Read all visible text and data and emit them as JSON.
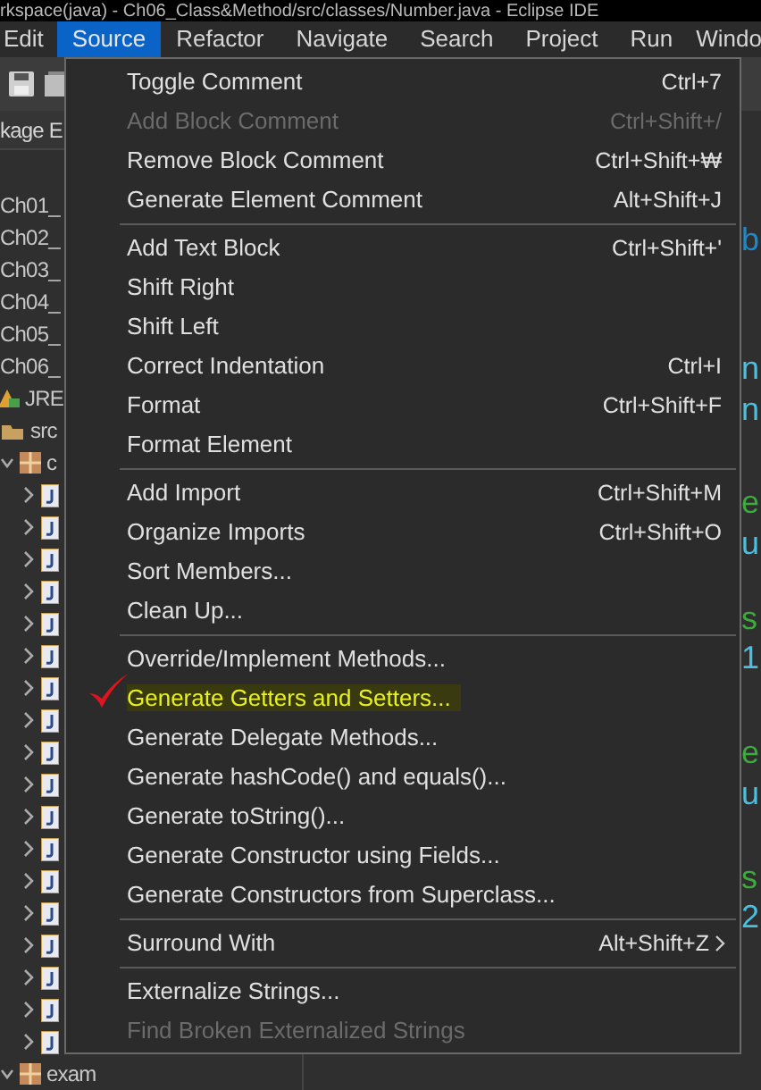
{
  "window": {
    "title": "rkspace(java) - Ch06_Class&Method/src/classes/Number.java - Eclipse IDE"
  },
  "menu_bar": [
    {
      "label": "Edit",
      "selected": false
    },
    {
      "label": "Source",
      "selected": true
    },
    {
      "label": "Refactor",
      "selected": false
    },
    {
      "label": "Navigate",
      "selected": false
    },
    {
      "label": "Search",
      "selected": false
    },
    {
      "label": "Project",
      "selected": false
    },
    {
      "label": "Run",
      "selected": false
    },
    {
      "label": "Windo",
      "selected": false
    }
  ],
  "left_panel": {
    "tab": "kage E",
    "tree": [
      {
        "label": "Ch01_",
        "kind": "project"
      },
      {
        "label": "Ch02_",
        "kind": "project"
      },
      {
        "label": "Ch03_",
        "kind": "project"
      },
      {
        "label": "Ch04_",
        "kind": "project"
      },
      {
        "label": "Ch05_",
        "kind": "project"
      },
      {
        "label": "Ch06_",
        "kind": "project"
      },
      {
        "label": "JRE",
        "kind": "library"
      },
      {
        "label": "src",
        "kind": "folder"
      },
      {
        "label": "c",
        "kind": "package",
        "expanded": true,
        "children": [
          {
            "kind": "java-file",
            "expanded": false
          },
          {
            "kind": "java-file",
            "expanded": false
          },
          {
            "kind": "java-file",
            "expanded": false
          },
          {
            "kind": "java-file",
            "expanded": false
          },
          {
            "kind": "java-file",
            "expanded": false
          },
          {
            "kind": "java-file",
            "expanded": false
          },
          {
            "kind": "java-file",
            "expanded": false
          },
          {
            "kind": "java-file",
            "expanded": false
          },
          {
            "kind": "java-file",
            "expanded": false
          },
          {
            "kind": "java-file",
            "expanded": false
          },
          {
            "kind": "java-file",
            "expanded": false
          },
          {
            "kind": "java-file",
            "expanded": false
          },
          {
            "kind": "java-file",
            "expanded": false
          },
          {
            "kind": "java-file",
            "expanded": false
          },
          {
            "kind": "java-file",
            "expanded": false
          },
          {
            "kind": "java-file",
            "expanded": false
          },
          {
            "kind": "java-file",
            "expanded": false
          },
          {
            "kind": "java-file",
            "expanded": false
          }
        ]
      },
      {
        "label": "exam",
        "kind": "package",
        "expanded": true
      }
    ]
  },
  "editor_fragments": [
    {
      "text": "b",
      "kind": "field"
    },
    {
      "text": "n",
      "kind": "type"
    },
    {
      "text": "n",
      "kind": "type"
    },
    {
      "text": "e",
      "kind": "comment"
    },
    {
      "text": "u",
      "kind": "type"
    },
    {
      "text": "s",
      "kind": "comment"
    },
    {
      "text": "1",
      "kind": "type"
    },
    {
      "text": "e",
      "kind": "comment"
    },
    {
      "text": "u",
      "kind": "type"
    },
    {
      "text": "s",
      "kind": "comment"
    },
    {
      "text": "2",
      "kind": "type"
    }
  ],
  "source_menu": [
    [
      {
        "label": "Toggle Comment",
        "shortcut": "Ctrl+7",
        "disabled": false,
        "submenu": false,
        "highlighted": false
      },
      {
        "label": "Add Block Comment",
        "shortcut": "Ctrl+Shift+/",
        "disabled": true,
        "submenu": false,
        "highlighted": false
      },
      {
        "label": "Remove Block Comment",
        "shortcut": "Ctrl+Shift+₩",
        "disabled": false,
        "submenu": false,
        "highlighted": false
      },
      {
        "label": "Generate Element Comment",
        "shortcut": "Alt+Shift+J",
        "disabled": false,
        "submenu": false,
        "highlighted": false
      }
    ],
    [
      {
        "label": "Add Text Block",
        "shortcut": "Ctrl+Shift+'",
        "disabled": false,
        "submenu": false,
        "highlighted": false
      },
      {
        "label": "Shift Right",
        "disabled": false,
        "submenu": false,
        "highlighted": false
      },
      {
        "label": "Shift Left",
        "disabled": false,
        "submenu": false,
        "highlighted": false
      },
      {
        "label": "Correct Indentation",
        "shortcut": "Ctrl+I",
        "disabled": false,
        "submenu": false,
        "highlighted": false
      },
      {
        "label": "Format",
        "shortcut": "Ctrl+Shift+F",
        "disabled": false,
        "submenu": false,
        "highlighted": false
      },
      {
        "label": "Format Element",
        "disabled": false,
        "submenu": false,
        "highlighted": false
      }
    ],
    [
      {
        "label": "Add Import",
        "shortcut": "Ctrl+Shift+M",
        "disabled": false,
        "submenu": false,
        "highlighted": false
      },
      {
        "label": "Organize Imports",
        "shortcut": "Ctrl+Shift+O",
        "disabled": false,
        "submenu": false,
        "highlighted": false
      },
      {
        "label": "Sort Members...",
        "disabled": false,
        "submenu": false,
        "highlighted": false
      },
      {
        "label": "Clean Up...",
        "disabled": false,
        "submenu": false,
        "highlighted": false
      }
    ],
    [
      {
        "label": "Override/Implement Methods...",
        "disabled": false,
        "submenu": false,
        "highlighted": false
      },
      {
        "label": "Generate Getters and Setters...",
        "disabled": false,
        "submenu": false,
        "highlighted": true
      },
      {
        "label": "Generate Delegate Methods...",
        "disabled": false,
        "submenu": false,
        "highlighted": false
      },
      {
        "label": "Generate hashCode() and equals()...",
        "disabled": false,
        "submenu": false,
        "highlighted": false
      },
      {
        "label": "Generate toString()...",
        "disabled": false,
        "submenu": false,
        "highlighted": false
      },
      {
        "label": "Generate Constructor using Fields...",
        "disabled": false,
        "submenu": false,
        "highlighted": false
      },
      {
        "label": "Generate Constructors from Superclass...",
        "disabled": false,
        "submenu": false,
        "highlighted": false
      }
    ],
    [
      {
        "label": "Surround With",
        "shortcut": "Alt+Shift+Z",
        "disabled": false,
        "submenu": true,
        "highlighted": false
      }
    ],
    [
      {
        "label": "Externalize Strings...",
        "disabled": false,
        "submenu": false,
        "highlighted": false
      },
      {
        "label": "Find Broken Externalized Strings",
        "disabled": true,
        "submenu": false,
        "highlighted": false
      }
    ]
  ]
}
